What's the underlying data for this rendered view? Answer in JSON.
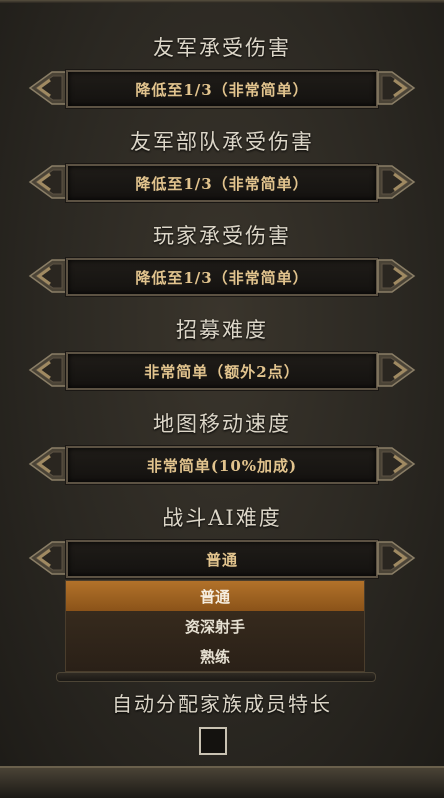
{
  "settings": [
    {
      "title": "友军承受伤害",
      "value": "降低至1/3（非常简单）"
    },
    {
      "title": "友军部队承受伤害",
      "value": "降低至1/3（非常简单）"
    },
    {
      "title": "玩家承受伤害",
      "value": "降低至1/3（非常简单）"
    },
    {
      "title": "招募难度",
      "value": "非常简单（额外2点）"
    },
    {
      "title": "地图移动速度",
      "value": "非常简单(10%加成)"
    },
    {
      "title": "战斗AI难度",
      "value": "普通"
    }
  ],
  "dropdown": {
    "options": [
      "普通",
      "资深射手",
      "熟练"
    ],
    "selected": "普通"
  },
  "checkbox": {
    "label": "自动分配家族成员特长",
    "checked": false
  },
  "colors": {
    "accent": "#b2722a",
    "value_text": "#e2c48e",
    "title_text": "#dcd6c8"
  }
}
